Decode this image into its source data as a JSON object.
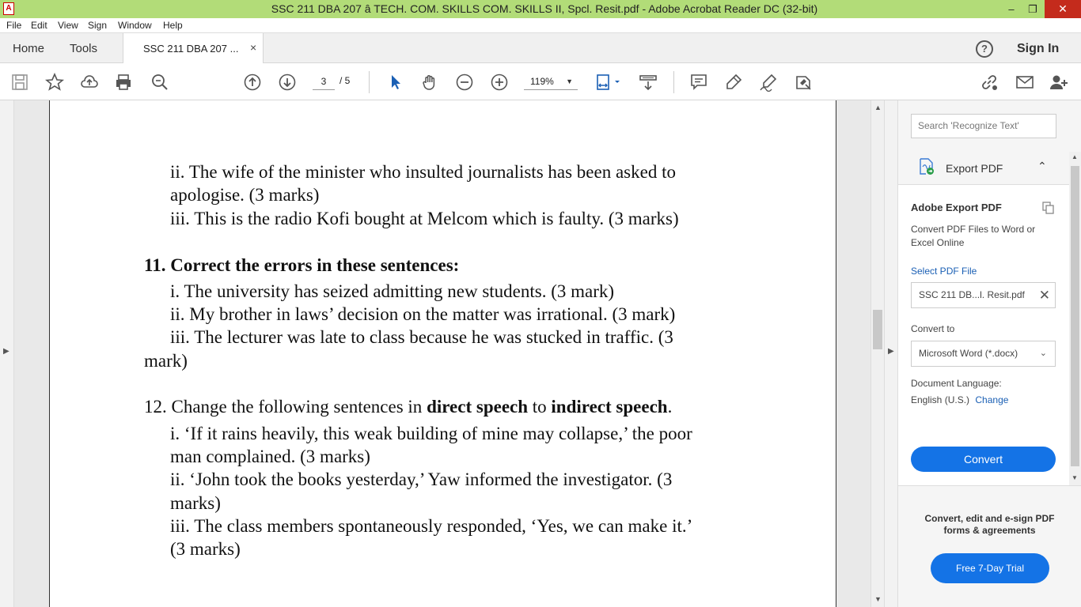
{
  "window": {
    "title": "SSC 211  DBA 207 â TECH. COM. SKILLS   COM. SKILLS II, Spcl. Resit.pdf - Adobe Acrobat Reader DC (32-bit)",
    "min": "–",
    "max": "❐",
    "close": "✕"
  },
  "menu": [
    "File",
    "Edit",
    "View",
    "Sign",
    "Window",
    "Help"
  ],
  "tabs": {
    "home": "Home",
    "tools": "Tools",
    "doc": "SSC 211  DBA 207 ...",
    "close": "×",
    "help": "?",
    "signin": "Sign In"
  },
  "toolbar": {
    "page_current": "3",
    "page_total": "/ 5",
    "zoom": "119%",
    "caret": "▼"
  },
  "document": {
    "lines": [
      {
        "t": "ii. The wife of the minister who insulted journalists has been asked to"
      },
      {
        "t": "apologise. (3 marks)"
      },
      {
        "t": "iii. This is the radio Kofi bought at Melcom which is faulty. (3 marks)"
      },
      {
        "t": "11. Correct the errors in these sentences:"
      },
      {
        "t": "i. The university has seized admitting new students. (3 mark)"
      },
      {
        "t": "ii. My brother in laws’ decision on the matter was irrational. (3 mark)"
      },
      {
        "t": "iii. The lecturer was late to class because he was stucked in traffic. (3"
      },
      {
        "t": "mark)"
      },
      {
        "a": "12. Change the following sentences in ",
        "b": "direct speech",
        "c": " to ",
        "d": "indirect speech",
        "e": "."
      },
      {
        "t": "i. ‘If it rains heavily, this weak building of mine may collapse,’ the poor"
      },
      {
        "t": "man complained. (3 marks)"
      },
      {
        "t": "ii. ‘John took the books yesterday,’ Yaw informed the investigator. (3"
      },
      {
        "t": "marks)"
      },
      {
        "t": "iii. The class members spontaneously responded, ‘Yes, we can make it.’"
      },
      {
        "t": "(3 marks)"
      }
    ]
  },
  "pane": {
    "search_placeholder": "Search 'Recognize Text'",
    "export_label": "Export PDF",
    "export_caret": "⌃",
    "aep_title": "Adobe Export PDF",
    "aep_desc": "Convert PDF Files to Word or Excel Online",
    "select_file": "Select PDF File",
    "file_name": "SSC 211 DB...l. Resit.pdf",
    "file_clear": "✕",
    "convert_to": "Convert to",
    "format": "Microsoft Word (*.docx)",
    "format_caret": "⌄",
    "lang_label": "Document Language:",
    "lang": "English (U.S.)",
    "lang_change": "Change",
    "convert_btn": "Convert",
    "promo": "Convert, edit and e-sign PDF forms & agreements",
    "trial_btn": "Free 7-Day Trial"
  },
  "scroll": {
    "up": "▲",
    "down": "▼",
    "left": "▶",
    "right": "▶"
  },
  "colors": {
    "titlebar": "#b2dc78",
    "accent": "#1473e6",
    "link": "#1a5fb4",
    "close": "#c42b1c"
  }
}
